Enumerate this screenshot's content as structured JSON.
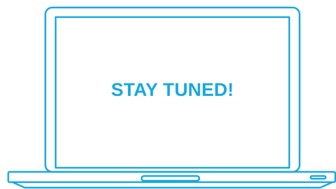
{
  "screen": {
    "message": "STAY TUNED!"
  },
  "colors": {
    "accent": "#19a7e0",
    "background": "#ffffff"
  },
  "icons": {
    "laptop": "laptop-icon",
    "trackpad": "trackpad-notch-icon",
    "indicator": "side-indicator-icon"
  }
}
